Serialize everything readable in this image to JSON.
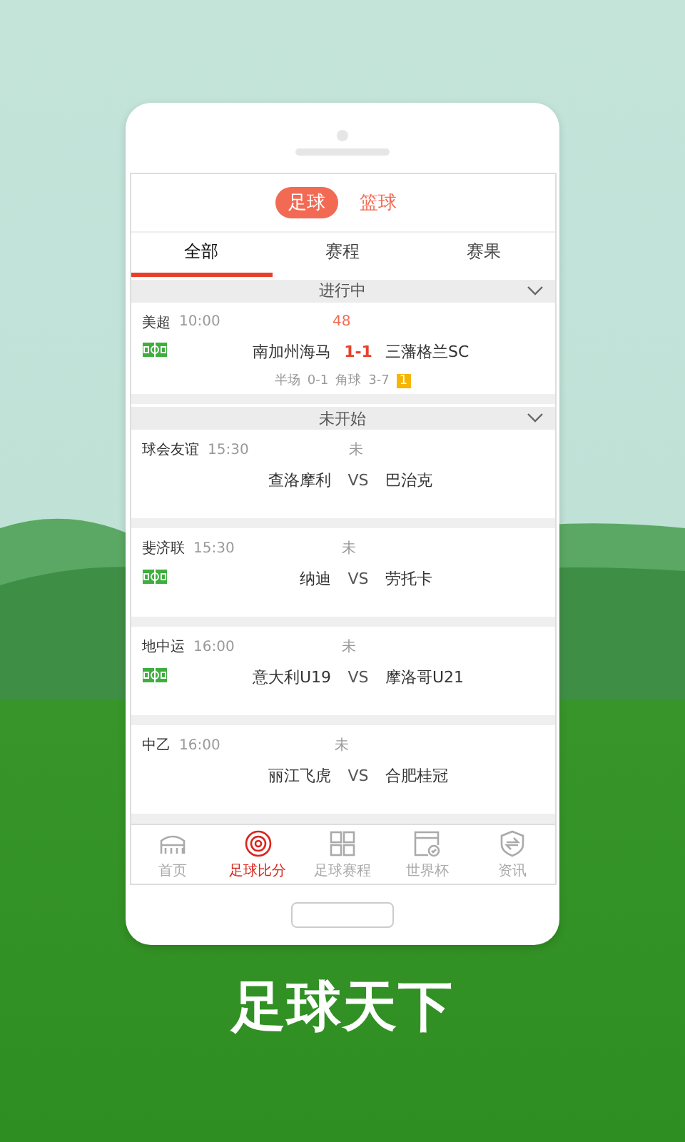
{
  "sport_tabs": [
    {
      "label": "足球",
      "selected": true
    },
    {
      "label": "篮球",
      "selected": false
    }
  ],
  "tabs": [
    {
      "label": "全部",
      "selected": true
    },
    {
      "label": "赛程",
      "selected": false
    },
    {
      "label": "赛果",
      "selected": false
    }
  ],
  "sections": [
    {
      "title": "进行中",
      "expanded": true,
      "matches": [
        {
          "league": "美超",
          "time": "10:00",
          "status": "48",
          "live": true,
          "field_icon": true,
          "home": "南加州海马",
          "score": "1-1",
          "away": "三藩格兰SC",
          "halftime_label": "半场",
          "halftime": "0-1",
          "corner_label": "角球",
          "corners": "3-7",
          "yellow_cards": "1"
        }
      ]
    },
    {
      "title": "未开始",
      "expanded": true,
      "matches": [
        {
          "league": "球会友谊",
          "time": "15:30",
          "status": "未",
          "live": false,
          "field_icon": false,
          "home": "查洛摩利",
          "score": "VS",
          "away": "巴治克"
        },
        {
          "league": "斐济联",
          "time": "15:30",
          "status": "未",
          "live": false,
          "field_icon": true,
          "home": "纳迪",
          "score": "VS",
          "away": "劳托卡"
        },
        {
          "league": "地中运",
          "time": "16:00",
          "status": "未",
          "live": false,
          "field_icon": true,
          "home": "意大利U19",
          "score": "VS",
          "away": "摩洛哥U21"
        },
        {
          "league": "中乙",
          "time": "16:00",
          "status": "未",
          "live": false,
          "field_icon": false,
          "home": "丽江飞虎",
          "score": "VS",
          "away": "合肥桂冠"
        }
      ]
    }
  ],
  "bottom_nav": [
    {
      "kind": "home",
      "label": "首页",
      "selected": false
    },
    {
      "kind": "score",
      "label": "足球比分",
      "selected": true
    },
    {
      "kind": "schedule",
      "label": "足球赛程",
      "selected": false
    },
    {
      "kind": "cup",
      "label": "世界杯",
      "selected": false
    },
    {
      "kind": "news",
      "label": "资讯",
      "selected": false
    }
  ],
  "promo_title": "足球天下"
}
